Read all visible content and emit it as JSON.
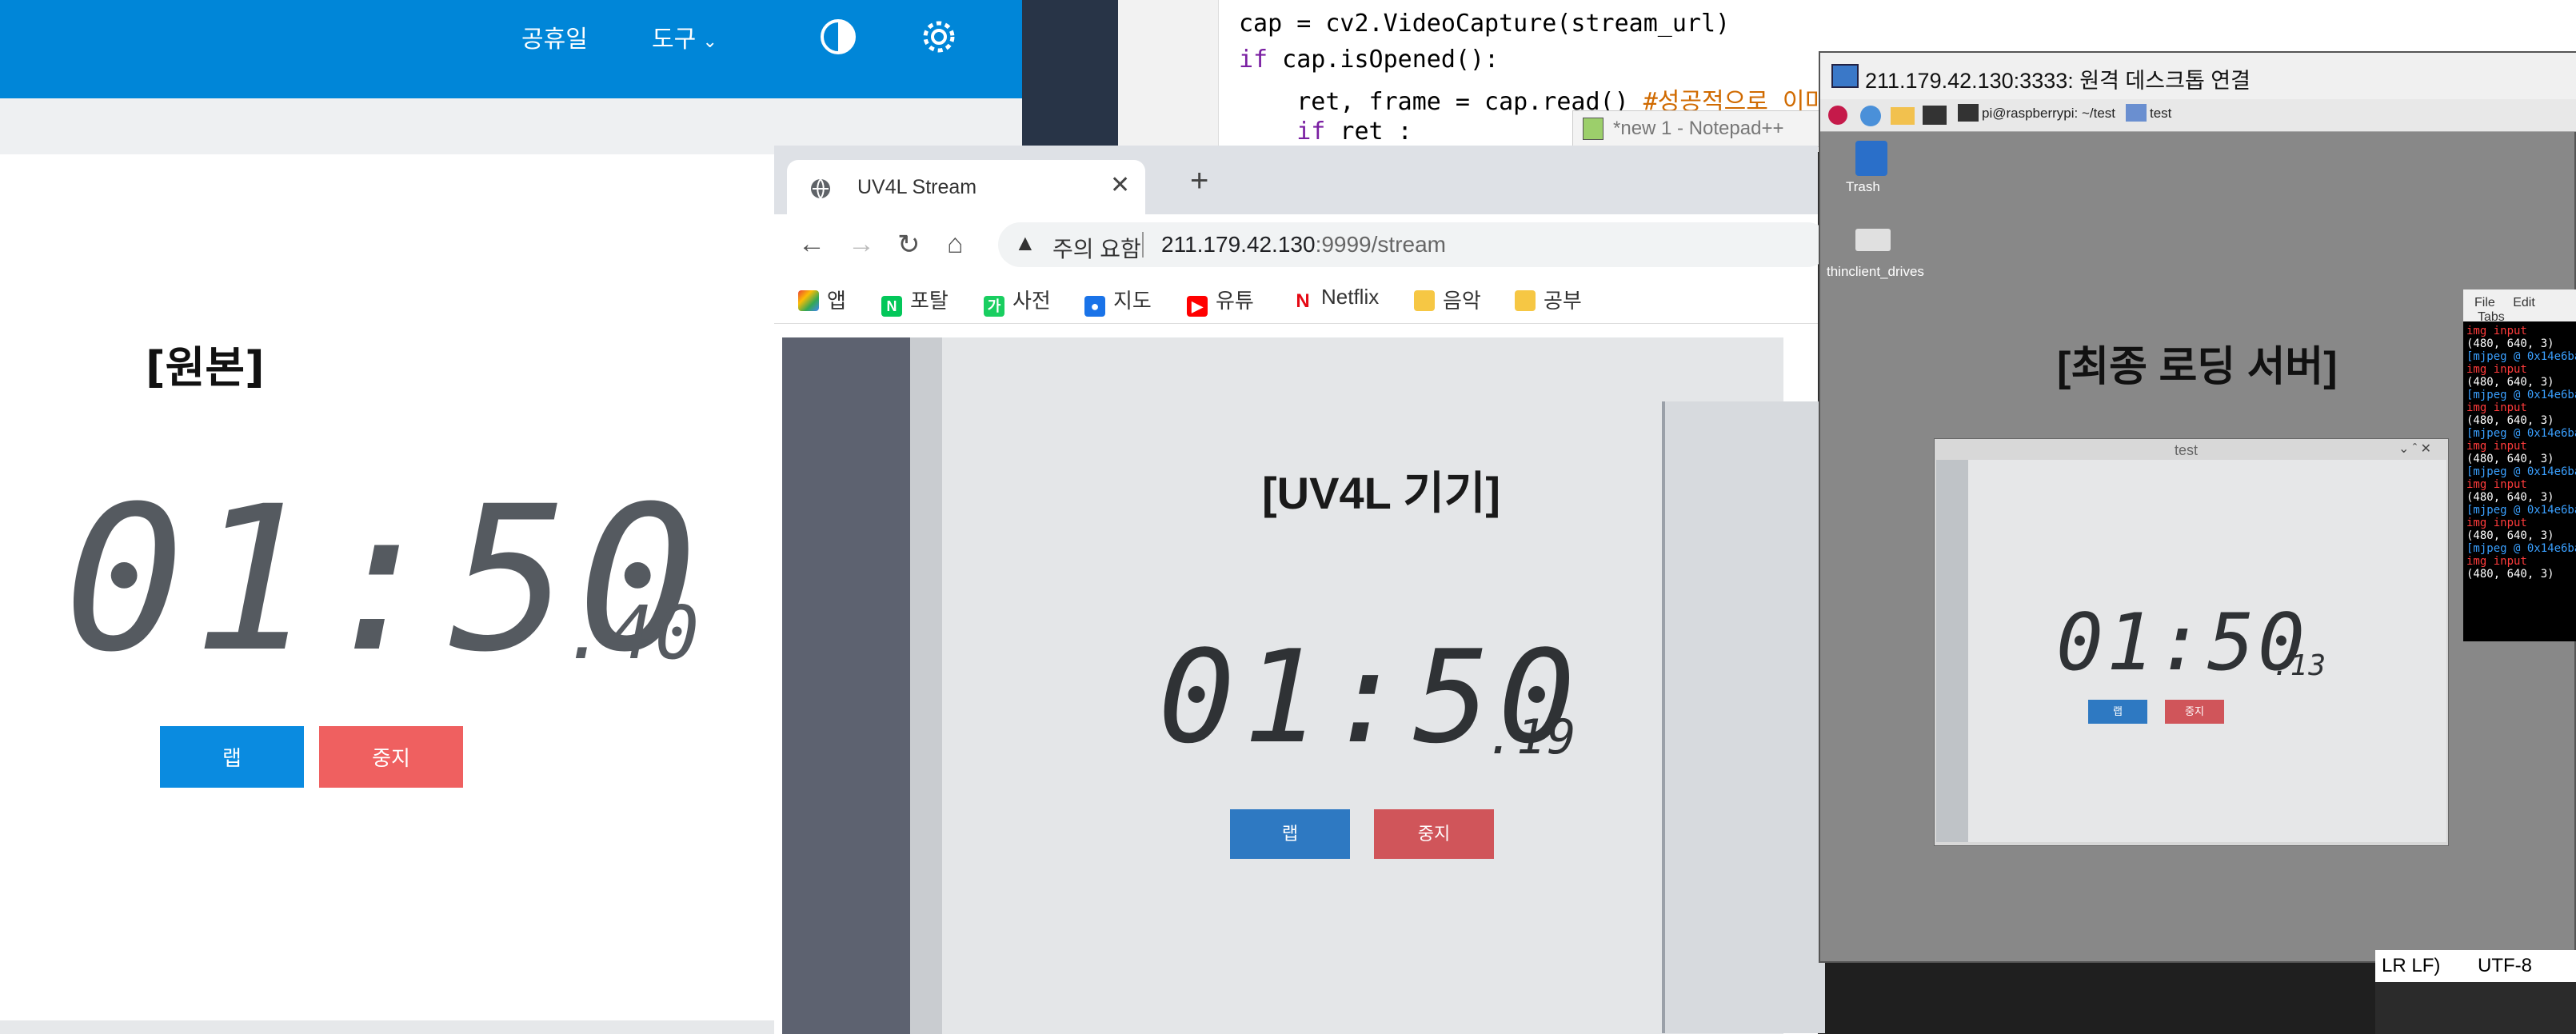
{
  "stopwatch": {
    "nav_holiday": "공휴일",
    "nav_tools": "도구",
    "label": "[원본]",
    "time_main": "01:50",
    "time_frac": ".40",
    "lap_label": "랩",
    "stop_label": "중지"
  },
  "code": {
    "line1": "cap = cv2.VideoCapture(stream_url)",
    "line2_kw": "if",
    "line2_rest": " cap.isOpened():",
    "line3_code": "    ret, frame = cap.read() ",
    "line3_comment": "#성공적으로 이미",
    "line4_kw": "    if",
    "line4_rest": " ret :"
  },
  "notepad": {
    "title": "*new 1 - Notepad++"
  },
  "browser": {
    "tab_title": "UV4L Stream",
    "url_warning": "주의 요함",
    "url_host": "211.179.42.130",
    "url_rest": ":9999/stream",
    "bookmarks": [
      "앱",
      "포탈",
      "사전",
      "지도",
      "유튜",
      "Netflix",
      "음악",
      "공부"
    ]
  },
  "stream": {
    "label": "[UV4L 기기]",
    "time_main": "01:50",
    "time_frac": ".19",
    "lap_label": "랩",
    "stop_label": "중지"
  },
  "rdp": {
    "title": "211.179.42.130:3333: 원격 데스크톱 연결",
    "task_terminal": "pi@raspberrypi: ~/test",
    "task_test": "test",
    "trash_label": "Trash",
    "drive_label": "thinclient_drives",
    "label": "[최종 로딩 서버]",
    "test_window_title": "test",
    "time_main": "01:50",
    "time_frac": ".13",
    "lap_label": "랩",
    "stop_label": "중지"
  },
  "terminal": {
    "menu": [
      "File",
      "Edit",
      "Tabs"
    ],
    "lines": [
      {
        "text": "img input",
        "color": "#ff3b3b"
      },
      {
        "text": "(480, 640, 3)",
        "color": "#ffffff"
      },
      {
        "text": "[mjpeg @ 0x14e6ba",
        "color": "#3aa0ff"
      },
      {
        "text": "img input",
        "color": "#ff3b3b"
      },
      {
        "text": "(480, 640, 3)",
        "color": "#ffffff"
      },
      {
        "text": "[mjpeg @ 0x14e6ba",
        "color": "#3aa0ff"
      },
      {
        "text": "img input",
        "color": "#ff3b3b"
      },
      {
        "text": "(480, 640, 3)",
        "color": "#ffffff"
      },
      {
        "text": "[mjpeg @ 0x14e6ba",
        "color": "#3aa0ff"
      },
      {
        "text": "img input",
        "color": "#ff3b3b"
      },
      {
        "text": "(480, 640, 3)",
        "color": "#ffffff"
      },
      {
        "text": "[mjpeg @ 0x14e6ba",
        "color": "#3aa0ff"
      },
      {
        "text": "img input",
        "color": "#ff3b3b"
      },
      {
        "text": "(480, 640, 3)",
        "color": "#ffffff"
      },
      {
        "text": "[mjpeg @ 0x14e6ba",
        "color": "#3aa0ff"
      },
      {
        "text": "img input",
        "color": "#ff3b3b"
      },
      {
        "text": "(480, 640, 3)",
        "color": "#ffffff"
      },
      {
        "text": "[mjpeg @ 0x14e6ba",
        "color": "#3aa0ff"
      },
      {
        "text": "img input",
        "color": "#ff3b3b"
      },
      {
        "text": "(480, 640, 3)",
        "color": "#ffffff"
      }
    ]
  },
  "statusbar": {
    "eol": "LR LF)",
    "encoding": "UTF-8"
  }
}
